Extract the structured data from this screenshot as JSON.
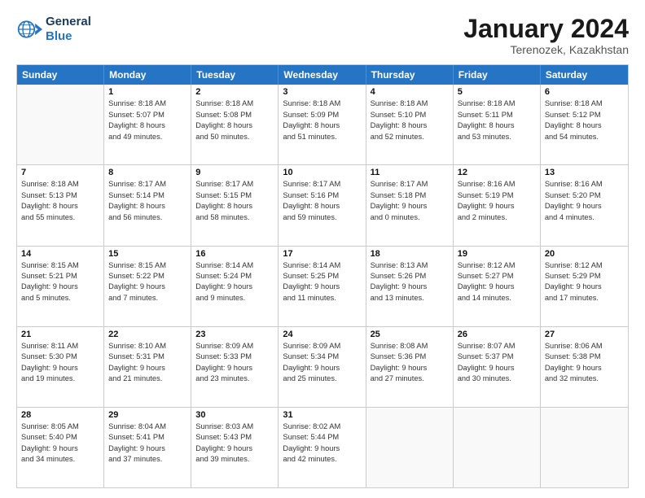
{
  "logo": {
    "line1": "General",
    "line2": "Blue"
  },
  "title": "January 2024",
  "subtitle": "Terenozek, Kazakhstan",
  "days": [
    "Sunday",
    "Monday",
    "Tuesday",
    "Wednesday",
    "Thursday",
    "Friday",
    "Saturday"
  ],
  "weeks": [
    [
      {
        "day": "",
        "sunrise": "",
        "sunset": "",
        "daylight": ""
      },
      {
        "day": "1",
        "sunrise": "Sunrise: 8:18 AM",
        "sunset": "Sunset: 5:07 PM",
        "daylight": "Daylight: 8 hours",
        "daylight2": "and 49 minutes."
      },
      {
        "day": "2",
        "sunrise": "Sunrise: 8:18 AM",
        "sunset": "Sunset: 5:08 PM",
        "daylight": "Daylight: 8 hours",
        "daylight2": "and 50 minutes."
      },
      {
        "day": "3",
        "sunrise": "Sunrise: 8:18 AM",
        "sunset": "Sunset: 5:09 PM",
        "daylight": "Daylight: 8 hours",
        "daylight2": "and 51 minutes."
      },
      {
        "day": "4",
        "sunrise": "Sunrise: 8:18 AM",
        "sunset": "Sunset: 5:10 PM",
        "daylight": "Daylight: 8 hours",
        "daylight2": "and 52 minutes."
      },
      {
        "day": "5",
        "sunrise": "Sunrise: 8:18 AM",
        "sunset": "Sunset: 5:11 PM",
        "daylight": "Daylight: 8 hours",
        "daylight2": "and 53 minutes."
      },
      {
        "day": "6",
        "sunrise": "Sunrise: 8:18 AM",
        "sunset": "Sunset: 5:12 PM",
        "daylight": "Daylight: 8 hours",
        "daylight2": "and 54 minutes."
      }
    ],
    [
      {
        "day": "7",
        "sunrise": "Sunrise: 8:18 AM",
        "sunset": "Sunset: 5:13 PM",
        "daylight": "Daylight: 8 hours",
        "daylight2": "and 55 minutes."
      },
      {
        "day": "8",
        "sunrise": "Sunrise: 8:17 AM",
        "sunset": "Sunset: 5:14 PM",
        "daylight": "Daylight: 8 hours",
        "daylight2": "and 56 minutes."
      },
      {
        "day": "9",
        "sunrise": "Sunrise: 8:17 AM",
        "sunset": "Sunset: 5:15 PM",
        "daylight": "Daylight: 8 hours",
        "daylight2": "and 58 minutes."
      },
      {
        "day": "10",
        "sunrise": "Sunrise: 8:17 AM",
        "sunset": "Sunset: 5:16 PM",
        "daylight": "Daylight: 8 hours",
        "daylight2": "and 59 minutes."
      },
      {
        "day": "11",
        "sunrise": "Sunrise: 8:17 AM",
        "sunset": "Sunset: 5:18 PM",
        "daylight": "Daylight: 9 hours",
        "daylight2": "and 0 minutes."
      },
      {
        "day": "12",
        "sunrise": "Sunrise: 8:16 AM",
        "sunset": "Sunset: 5:19 PM",
        "daylight": "Daylight: 9 hours",
        "daylight2": "and 2 minutes."
      },
      {
        "day": "13",
        "sunrise": "Sunrise: 8:16 AM",
        "sunset": "Sunset: 5:20 PM",
        "daylight": "Daylight: 9 hours",
        "daylight2": "and 4 minutes."
      }
    ],
    [
      {
        "day": "14",
        "sunrise": "Sunrise: 8:15 AM",
        "sunset": "Sunset: 5:21 PM",
        "daylight": "Daylight: 9 hours",
        "daylight2": "and 5 minutes."
      },
      {
        "day": "15",
        "sunrise": "Sunrise: 8:15 AM",
        "sunset": "Sunset: 5:22 PM",
        "daylight": "Daylight: 9 hours",
        "daylight2": "and 7 minutes."
      },
      {
        "day": "16",
        "sunrise": "Sunrise: 8:14 AM",
        "sunset": "Sunset: 5:24 PM",
        "daylight": "Daylight: 9 hours",
        "daylight2": "and 9 minutes."
      },
      {
        "day": "17",
        "sunrise": "Sunrise: 8:14 AM",
        "sunset": "Sunset: 5:25 PM",
        "daylight": "Daylight: 9 hours",
        "daylight2": "and 11 minutes."
      },
      {
        "day": "18",
        "sunrise": "Sunrise: 8:13 AM",
        "sunset": "Sunset: 5:26 PM",
        "daylight": "Daylight: 9 hours",
        "daylight2": "and 13 minutes."
      },
      {
        "day": "19",
        "sunrise": "Sunrise: 8:12 AM",
        "sunset": "Sunset: 5:27 PM",
        "daylight": "Daylight: 9 hours",
        "daylight2": "and 14 minutes."
      },
      {
        "day": "20",
        "sunrise": "Sunrise: 8:12 AM",
        "sunset": "Sunset: 5:29 PM",
        "daylight": "Daylight: 9 hours",
        "daylight2": "and 17 minutes."
      }
    ],
    [
      {
        "day": "21",
        "sunrise": "Sunrise: 8:11 AM",
        "sunset": "Sunset: 5:30 PM",
        "daylight": "Daylight: 9 hours",
        "daylight2": "and 19 minutes."
      },
      {
        "day": "22",
        "sunrise": "Sunrise: 8:10 AM",
        "sunset": "Sunset: 5:31 PM",
        "daylight": "Daylight: 9 hours",
        "daylight2": "and 21 minutes."
      },
      {
        "day": "23",
        "sunrise": "Sunrise: 8:09 AM",
        "sunset": "Sunset: 5:33 PM",
        "daylight": "Daylight: 9 hours",
        "daylight2": "and 23 minutes."
      },
      {
        "day": "24",
        "sunrise": "Sunrise: 8:09 AM",
        "sunset": "Sunset: 5:34 PM",
        "daylight": "Daylight: 9 hours",
        "daylight2": "and 25 minutes."
      },
      {
        "day": "25",
        "sunrise": "Sunrise: 8:08 AM",
        "sunset": "Sunset: 5:36 PM",
        "daylight": "Daylight: 9 hours",
        "daylight2": "and 27 minutes."
      },
      {
        "day": "26",
        "sunrise": "Sunrise: 8:07 AM",
        "sunset": "Sunset: 5:37 PM",
        "daylight": "Daylight: 9 hours",
        "daylight2": "and 30 minutes."
      },
      {
        "day": "27",
        "sunrise": "Sunrise: 8:06 AM",
        "sunset": "Sunset: 5:38 PM",
        "daylight": "Daylight: 9 hours",
        "daylight2": "and 32 minutes."
      }
    ],
    [
      {
        "day": "28",
        "sunrise": "Sunrise: 8:05 AM",
        "sunset": "Sunset: 5:40 PM",
        "daylight": "Daylight: 9 hours",
        "daylight2": "and 34 minutes."
      },
      {
        "day": "29",
        "sunrise": "Sunrise: 8:04 AM",
        "sunset": "Sunset: 5:41 PM",
        "daylight": "Daylight: 9 hours",
        "daylight2": "and 37 minutes."
      },
      {
        "day": "30",
        "sunrise": "Sunrise: 8:03 AM",
        "sunset": "Sunset: 5:43 PM",
        "daylight": "Daylight: 9 hours",
        "daylight2": "and 39 minutes."
      },
      {
        "day": "31",
        "sunrise": "Sunrise: 8:02 AM",
        "sunset": "Sunset: 5:44 PM",
        "daylight": "Daylight: 9 hours",
        "daylight2": "and 42 minutes."
      },
      {
        "day": "",
        "sunrise": "",
        "sunset": "",
        "daylight": "",
        "daylight2": ""
      },
      {
        "day": "",
        "sunrise": "",
        "sunset": "",
        "daylight": "",
        "daylight2": ""
      },
      {
        "day": "",
        "sunrise": "",
        "sunset": "",
        "daylight": "",
        "daylight2": ""
      }
    ]
  ]
}
